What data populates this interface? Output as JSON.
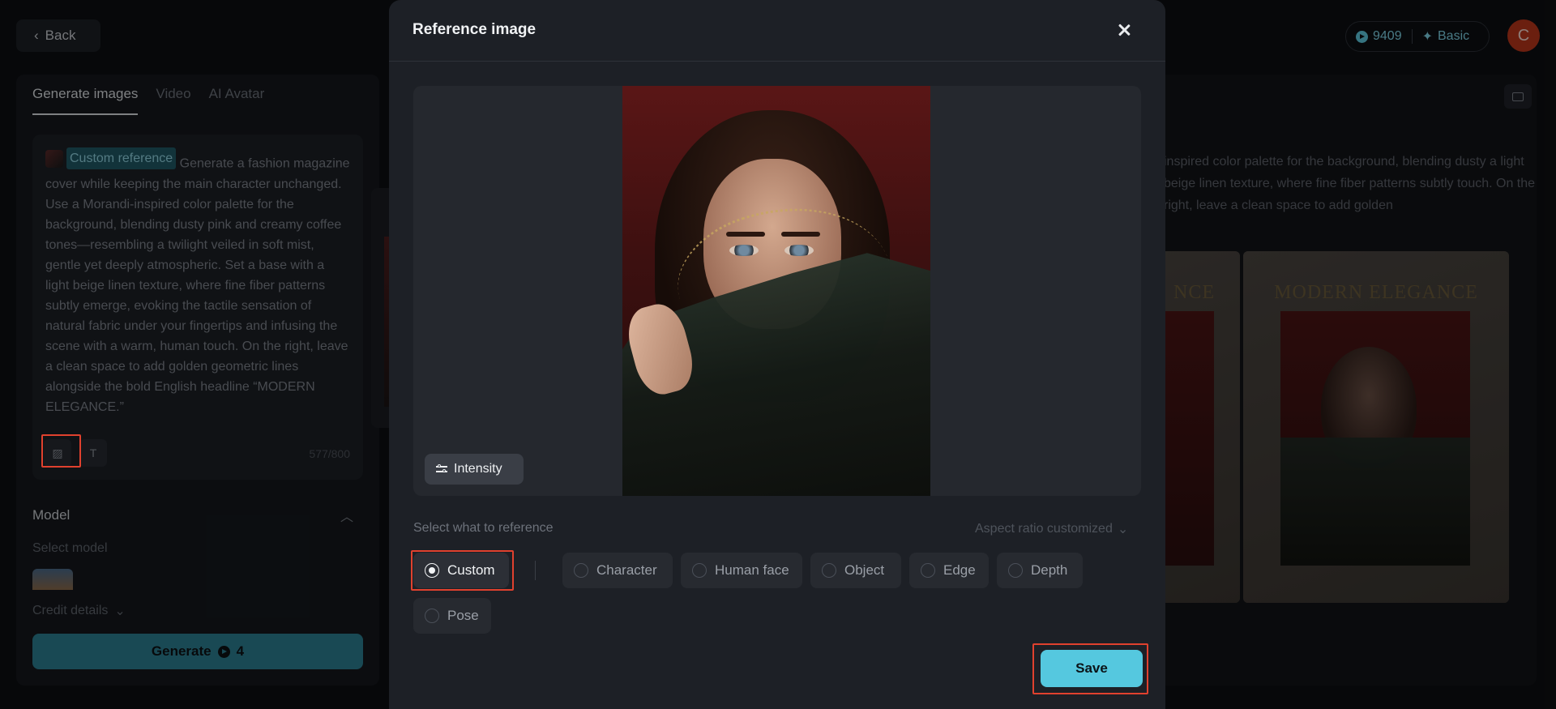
{
  "app": {
    "back_label": "Back",
    "credits": "9409",
    "plan": "Basic",
    "avatar_letter": "C"
  },
  "left_panel": {
    "tabs": [
      {
        "label": "Generate images",
        "active": true
      },
      {
        "label": "Video",
        "active": false
      },
      {
        "label": "AI Avatar",
        "active": false
      }
    ],
    "prompt": {
      "chip_label": "Custom reference",
      "text": "Generate a fashion magazine cover while keeping the main character unchanged. Use a Morandi-inspired color palette for the background, blending dusty pink and creamy coffee tones—resembling a twilight veiled in soft mist, gentle yet deeply atmospheric. Set a base with a light beige linen texture, where fine fiber patterns subtly emerge, evoking the tactile sensation of natural fabric under your fingertips and infusing the scene with a warm, human touch. On the right, leave a clean space to add golden geometric lines alongside the bold English headline “MODERN ELEGANCE.”",
      "counter": "577/800"
    },
    "model_label": "Model",
    "select_model_label": "Select model",
    "credit_details_label": "Credit details",
    "generate_label": "Generate",
    "generate_cost": "4"
  },
  "result": {
    "text": "inspired color palette for the background, blending dusty a light beige linen texture, where fine fiber patterns subtly touch. On the right, leave a clean space to add golden",
    "headline_partial": "NCE",
    "headline": "MODERN ELEGANCE"
  },
  "modal": {
    "title": "Reference image",
    "intensity_label": "Intensity",
    "reference_heading": "Select what to reference",
    "aspect_label": "Aspect ratio customized",
    "options": [
      {
        "label": "Custom",
        "selected": true
      },
      {
        "label": "Character",
        "selected": false
      },
      {
        "label": "Human face",
        "selected": false
      },
      {
        "label": "Object",
        "selected": false
      },
      {
        "label": "Edge",
        "selected": false
      },
      {
        "label": "Depth",
        "selected": false
      },
      {
        "label": "Pose",
        "selected": false
      }
    ],
    "save_label": "Save"
  },
  "colors": {
    "accent": "#55c8df",
    "highlight": "#e0412e",
    "modal_bg": "#1d2026"
  }
}
